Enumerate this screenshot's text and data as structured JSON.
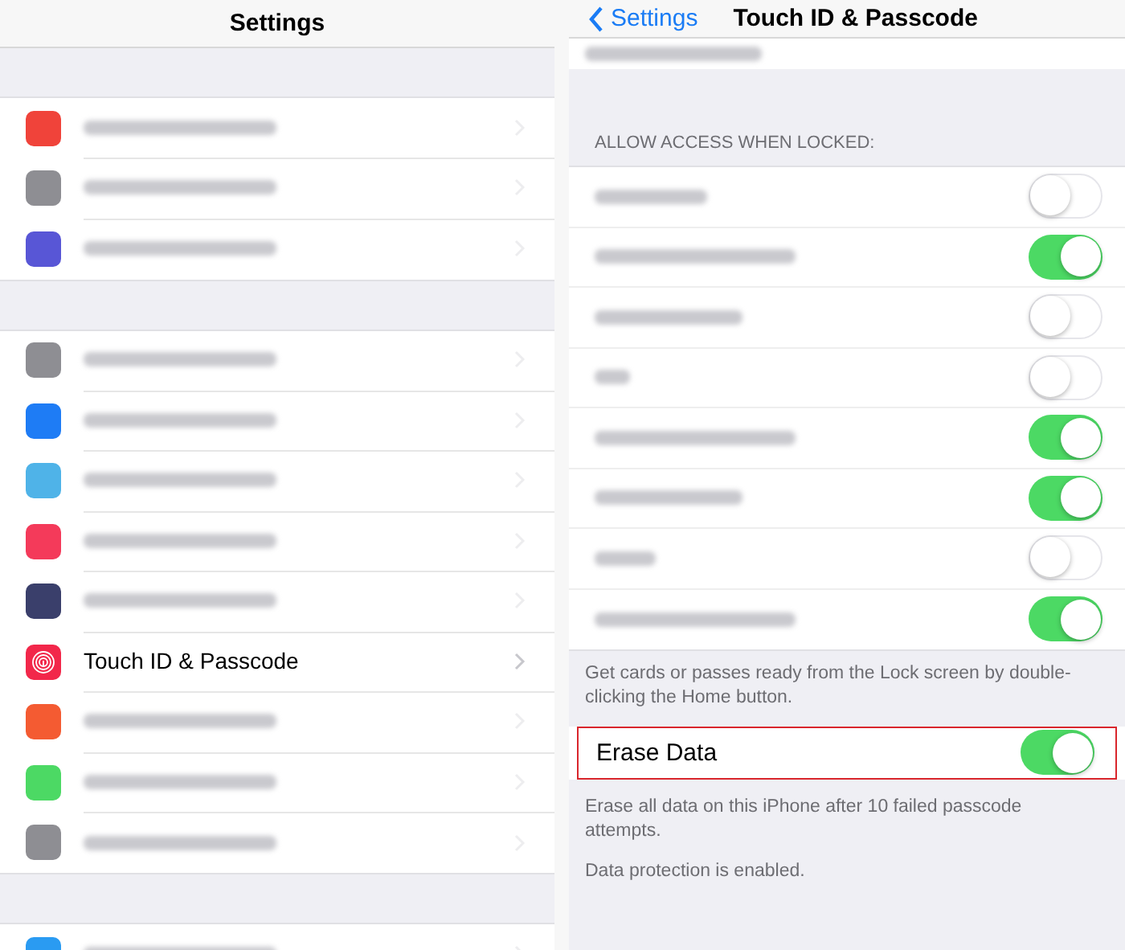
{
  "left": {
    "title": "Settings",
    "groups": [
      [
        {
          "color": "#f0433a"
        },
        {
          "color": "#8e8e93"
        },
        {
          "color": "#5856d6"
        }
      ],
      [
        {
          "color": "#8e8e93"
        },
        {
          "color": "#1e7cf5"
        },
        {
          "color": "#4fb3e8"
        },
        {
          "color": "#f43a5a"
        },
        {
          "color": "#3a3f6b"
        },
        {
          "label": "Touch ID & Passcode",
          "color": "#f2274a"
        },
        {
          "color": "#f45b32"
        },
        {
          "color": "#4cd964"
        },
        {
          "color": "#8e8e93"
        }
      ],
      [
        {
          "color": "#2a9bf2"
        }
      ]
    ]
  },
  "right": {
    "back": "Settings",
    "title": "Touch ID & Passcode",
    "section_header": "ALLOW ACCESS WHEN LOCKED:",
    "toggles": [
      {
        "on": false
      },
      {
        "on": true
      },
      {
        "on": false
      },
      {
        "on": false
      },
      {
        "on": true
      },
      {
        "on": true
      },
      {
        "on": false
      },
      {
        "on": true
      }
    ],
    "toggles_footer": "Get cards or passes ready from the Lock screen by double-clicking the Home button.",
    "erase": {
      "label": "Erase Data",
      "on": true,
      "highlighted": true
    },
    "erase_footer": "Erase all data on this iPhone after 10 failed passcode attempts.",
    "protection_note": "Data protection is enabled."
  }
}
